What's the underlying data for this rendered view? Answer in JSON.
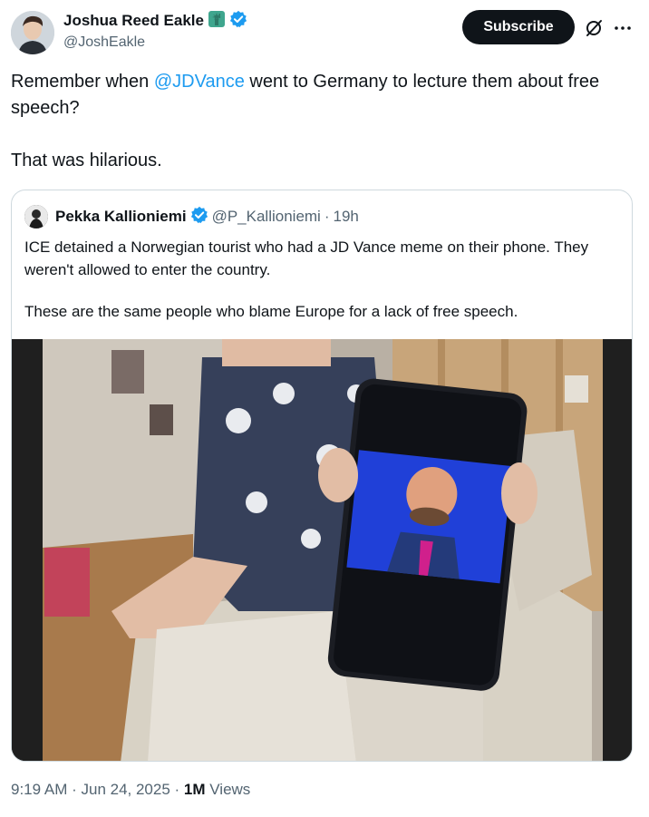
{
  "author": {
    "display_name": "Joshua Reed Eakle",
    "handle": "@JoshEakle",
    "emoji_badge": "statue-of-liberty-emoji",
    "verified": true
  },
  "header": {
    "subscribe_label": "Subscribe",
    "grok_icon": "slashed-circle-icon",
    "more_icon": "more-horizontal-icon"
  },
  "tweet": {
    "line1_pre": "Remember when ",
    "mention": "@JDVance",
    "line1_post": " went to Germany to lecture them about free speech?",
    "line2": "That was hilarious."
  },
  "quote": {
    "display_name": "Pekka Kallioniemi",
    "handle": "@P_Kallioniemi",
    "separator": "·",
    "time": "19h",
    "verified": true,
    "text_line1": "ICE detained a Norwegian tourist who had a JD Vance meme on their phone. They weren't allowed to enter the country.",
    "text_line2": "These are the same people who blame Europe for a lack of free speech.",
    "media": "photo of a person holding a phone showing a bald bearded man on screen"
  },
  "footer": {
    "time": "9:19 AM",
    "sep1": " · ",
    "date": "Jun 24, 2025",
    "sep2": " · ",
    "views_count": "1M",
    "views_label": " Views"
  },
  "colors": {
    "link": "#1d9bf0",
    "text": "#0f1419",
    "secondary": "#536471",
    "border": "#cfd9de",
    "verified": "#1d9bf0"
  }
}
